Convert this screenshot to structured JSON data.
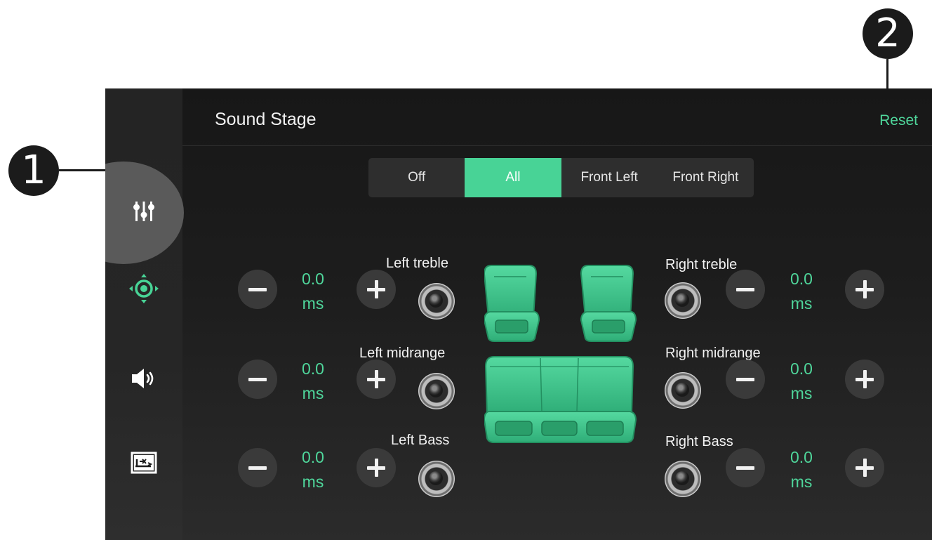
{
  "callouts": {
    "one": "1",
    "two": "2"
  },
  "header": {
    "title": "Sound Stage",
    "reset_label": "Reset"
  },
  "modes": [
    {
      "label": "Off",
      "active": false
    },
    {
      "label": "All",
      "active": true
    },
    {
      "label": "Front Left",
      "active": false
    },
    {
      "label": "Front Right",
      "active": false
    }
  ],
  "sidebar": {
    "items": [
      {
        "icon": "equalizer-sliders-icon",
        "active": true
      },
      {
        "icon": "sound-position-icon",
        "active": false
      },
      {
        "icon": "speaker-volume-icon",
        "active": false
      },
      {
        "icon": "graph-settings-icon",
        "active": false
      }
    ]
  },
  "channels": {
    "left_treble": {
      "label": "Left treble",
      "value": "0.0",
      "unit": "ms"
    },
    "left_midrange": {
      "label": "Left midrange",
      "value": "0.0",
      "unit": "ms"
    },
    "left_bass": {
      "label": "Left Bass",
      "value": "0.0",
      "unit": "ms"
    },
    "right_treble": {
      "label": "Right treble",
      "value": "0.0",
      "unit": "ms"
    },
    "right_midrange": {
      "label": "Right midrange",
      "value": "0.0",
      "unit": "ms"
    },
    "right_bass": {
      "label": "Right Bass",
      "value": "0.0",
      "unit": "ms"
    }
  },
  "colors": {
    "accent": "#48d396",
    "accent_text": "#4fd69b",
    "background": "#1d1d1d",
    "button": "#3a3a3a"
  }
}
